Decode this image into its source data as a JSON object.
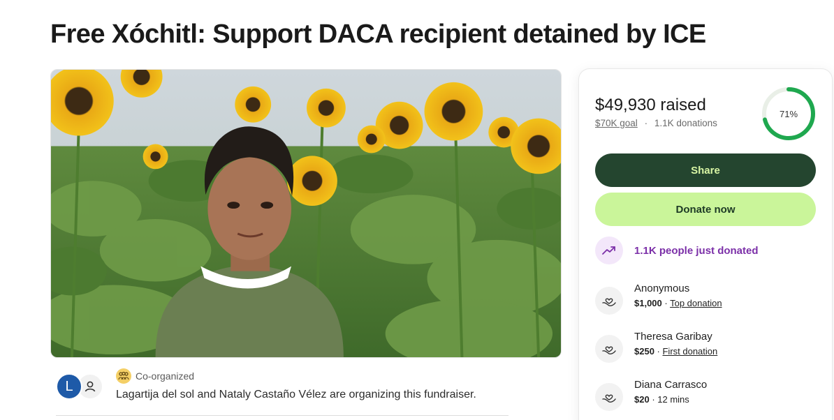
{
  "page": {
    "title": "Free Xóchitl: Support DACA recipient detained by ICE"
  },
  "organizer": {
    "avatar_initial": "L",
    "badge_label": "Co-organized",
    "text": "Lagartija del sol and Nataly Castaño Vélez are organizing this fundraiser."
  },
  "donation_card": {
    "raised": "$49,930 raised",
    "goal": "$70K goal",
    "separator": "·",
    "donations_count": "1.1K donations",
    "progress_label": "71%",
    "progress_fraction": 0.71,
    "share_label": "Share",
    "donate_label": "Donate now",
    "trend_text": "1.1K people just donated",
    "donors": [
      {
        "name": "Anonymous",
        "amount": "$1,000",
        "sep": " · ",
        "note": "Top donation",
        "note_link": true
      },
      {
        "name": "Theresa Garibay",
        "amount": "$250",
        "sep": " · ",
        "note": "First donation",
        "note_link": true
      },
      {
        "name": "Diana Carrasco",
        "amount": "$20",
        "sep": " · ",
        "note": "12 mins",
        "note_link": false
      }
    ]
  },
  "colors": {
    "share_bg": "#24452f",
    "donate_bg": "#caf59a",
    "progress": "#1fa84f",
    "trend_purple": "#7b2fa8"
  },
  "icons": {
    "trend": "trending-up-icon",
    "donor": "heart-hand-icon",
    "person": "person-icon",
    "group": "group-icon"
  }
}
